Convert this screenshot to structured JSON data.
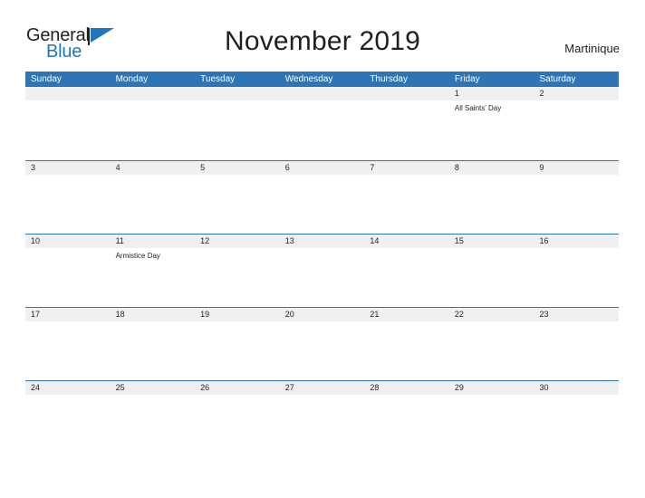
{
  "brand": {
    "word_one": "General",
    "word_two": "Blue",
    "flag_icon": "flag-triangle-icon"
  },
  "header": {
    "title": "November 2019",
    "region": "Martinique"
  },
  "colors": {
    "header_blue": "#2e75b6",
    "date_band_gray": "#f0f0f0",
    "brand_blue": "#1f76bc",
    "text": "#231f20",
    "page_background": "#ffffff"
  },
  "calendar": {
    "weekday_headers": [
      "Sunday",
      "Monday",
      "Tuesday",
      "Wednesday",
      "Thursday",
      "Friday",
      "Saturday"
    ],
    "weeks": [
      {
        "dates": [
          "",
          "",
          "",
          "",
          "",
          "1",
          "2"
        ],
        "events": [
          "",
          "",
          "",
          "",
          "",
          "All Saints' Day",
          ""
        ]
      },
      {
        "dates": [
          "3",
          "4",
          "5",
          "6",
          "7",
          "8",
          "9"
        ],
        "events": [
          "",
          "",
          "",
          "",
          "",
          "",
          ""
        ]
      },
      {
        "dates": [
          "10",
          "11",
          "12",
          "13",
          "14",
          "15",
          "16"
        ],
        "events": [
          "",
          "Armistice Day",
          "",
          "",
          "",
          "",
          ""
        ]
      },
      {
        "dates": [
          "17",
          "18",
          "19",
          "20",
          "21",
          "22",
          "23"
        ],
        "events": [
          "",
          "",
          "",
          "",
          "",
          "",
          ""
        ]
      },
      {
        "dates": [
          "24",
          "25",
          "26",
          "27",
          "28",
          "29",
          "30"
        ],
        "events": [
          "",
          "",
          "",
          "",
          "",
          "",
          ""
        ]
      }
    ]
  }
}
